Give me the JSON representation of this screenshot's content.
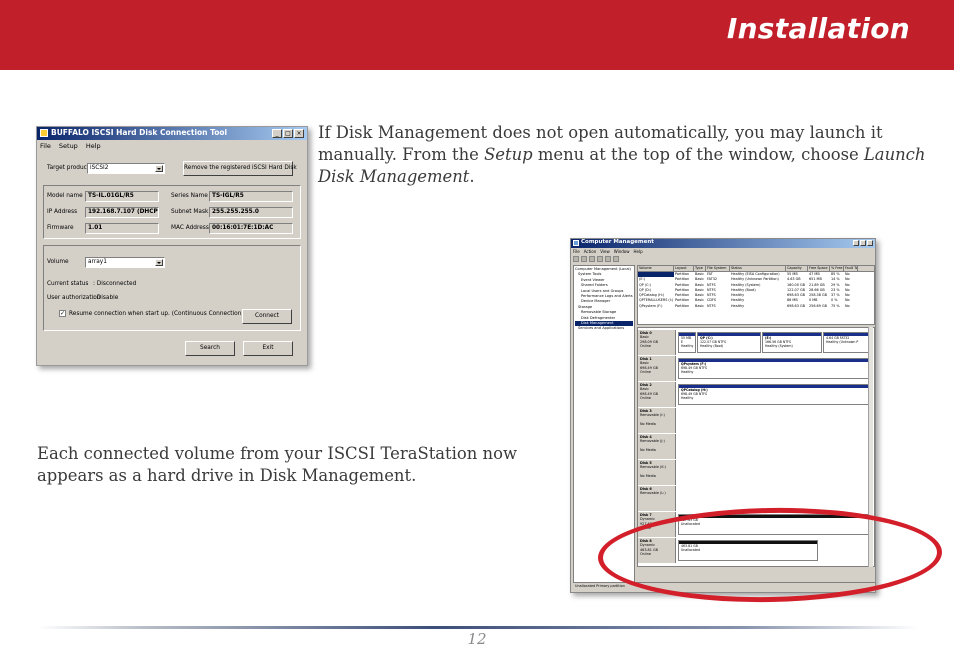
{
  "header": {
    "title": "Installation"
  },
  "paragraphs": {
    "p1": {
      "before_setup": "If Disk Management does not open automatically, you may launch it manually.  From the ",
      "setup": "Setup",
      "middle": " menu at the top of the window, choose ",
      "launch": "Launch Disk Management",
      "end": "."
    },
    "p2": "Each connected volume from your ISCSI TeraStation now appears as a hard drive in Disk Management."
  },
  "dialog": {
    "title": "BUFFALO ISCSI Hard Disk Connection Tool",
    "menu": [
      "File",
      "Setup",
      "Help"
    ],
    "target_product_label": "Target product",
    "target_product_value": "iSCSI2",
    "remove_button": "Remove the registered iSCSI Hard Disk",
    "model_name_label": "Model name",
    "model_name_value": "TS-IL.01GL/R5",
    "series_name_label": "Series Name",
    "series_name_value": "TS-IGL/R5",
    "ip_label": "IP Address",
    "ip_value": "192.168.7.107 (DHCP)",
    "subnet_label": "Subnet Mask",
    "subnet_value": "255.255.255.0",
    "firmware_label": "Firmware",
    "firmware_value": "1.01",
    "mac_label": "MAC Address",
    "mac_value": "00:16:01:7E:1D:AC",
    "volume_label": "Volume",
    "volume_value": "array1",
    "current_status_label": "Current status",
    "current_status_value": ": Disconnected",
    "user_auth_label": "User authorization",
    "user_auth_value": ": Disable",
    "resume_check": "Resume connection when start up. (Continuous Connection)",
    "connect_button": "Connect",
    "search_button": "Search",
    "exit_button": "Exit"
  },
  "disk_mgmt": {
    "title": "Computer Management",
    "menu": [
      "File",
      "Action",
      "View",
      "Window",
      "Help"
    ],
    "tree": [
      "Computer Management (Local)",
      "System Tools",
      "Event Viewer",
      "Shared Folders",
      "Local Users and Groups",
      "Performance Logs and Alerts",
      "Device Manager",
      "Storage",
      "Removable Storage",
      "Disk Defragmenter",
      "Disk Management",
      "Services and Applications"
    ],
    "columns": [
      "Volume",
      "Layout",
      "Type",
      "File System",
      "Status",
      "Capacity",
      "Free Space",
      "% Free",
      "Fault To"
    ],
    "rows": [
      [
        "",
        "Partition",
        "Basic",
        "FAT",
        "Healthy (EISA Configuration)",
        "55 MB",
        "47 MB",
        "85 %",
        "No"
      ],
      [
        "(E:)",
        "Partition",
        "Basic",
        "FAT32",
        "Healthy (Unknown Partition)",
        "4.63 GB",
        "651 MB",
        "14 %",
        "No"
      ],
      [
        "QP (C:)",
        "Partition",
        "Basic",
        "NTFS",
        "Healthy (System)",
        "160.00 GB",
        "21.89 GB",
        "29 %",
        "No"
      ],
      [
        "QP (D:)",
        "Partition",
        "Basic",
        "NTFS",
        "Healthy (Boot)",
        "122.07 GB",
        "28.66 GB",
        "23 %",
        "No"
      ],
      [
        "QPCatalog (H:)",
        "Partition",
        "Basic",
        "NTFS",
        "Healthy",
        "698.63 GB",
        "258.38 GB",
        "37 %",
        "No"
      ],
      [
        "QPTERALLUSERS (I:)",
        "Partition",
        "Basic",
        "CDFS",
        "Healthy",
        "86 MB",
        "0 MB",
        "0 %",
        "No"
      ],
      [
        "QPsystem (F:)",
        "Partition",
        "Basic",
        "NTFS",
        "Healthy",
        "698.63 GB",
        "256.69 GB",
        "75 %",
        "No"
      ]
    ],
    "disks": [
      {
        "name": "Disk 0",
        "type": "Basic",
        "size": "298.09 GB",
        "state": "Online",
        "parts": [
          {
            "title": "",
            "line1": "55 MB E",
            "line2": "Healthy"
          },
          {
            "title": "QP (C:)",
            "line1": "122.07 GB NTFS",
            "line2": "Healthy (Boot)"
          },
          {
            "title": "(E:)",
            "line1": "166.56 GB NTFS",
            "line2": "Healthy (System)"
          },
          {
            "title": "",
            "line1": "4.64 GB FAT32",
            "line2": "Healthy (Unknown P"
          }
        ]
      },
      {
        "name": "Disk 1",
        "type": "Basic",
        "size": "698.49 GB",
        "state": "Online",
        "parts": [
          {
            "title": "QPsystem (F:)",
            "line1": "698.49 GB NTFS",
            "line2": "Healthy"
          }
        ]
      },
      {
        "name": "Disk 2",
        "type": "Basic",
        "size": "698.49 GB",
        "state": "Online",
        "parts": [
          {
            "title": "QPCatalog (H:)",
            "line1": "698.49 GB NTFS",
            "line2": "Healthy"
          }
        ]
      },
      {
        "name": "Disk 3",
        "type": "Removable (I:)",
        "size": "",
        "state": "No Media",
        "parts": []
      },
      {
        "name": "Disk 4",
        "type": "Removable (J:)",
        "size": "",
        "state": "No Media",
        "parts": []
      },
      {
        "name": "Disk 5",
        "type": "Removable (K:)",
        "size": "",
        "state": "No Media",
        "parts": []
      },
      {
        "name": "Disk 6",
        "type": "Removable (L:)",
        "size": "",
        "state": "",
        "parts": []
      },
      {
        "name": "Disk 7",
        "type": "Dynamic",
        "size": "927.63 GB",
        "state": "Online",
        "parts": [
          {
            "title": "",
            "line1": "927.63 GB",
            "line2": "Unallocated"
          }
        ]
      },
      {
        "name": "Disk 8",
        "type": "Dynamic",
        "size": "463.81 GB",
        "state": "Online",
        "parts": [
          {
            "title": "",
            "line1": "463.81 GB",
            "line2": "Unallocated"
          }
        ]
      }
    ],
    "status_bar": "Unallocated   Primary partition"
  },
  "footer": {
    "page_number": "12"
  }
}
